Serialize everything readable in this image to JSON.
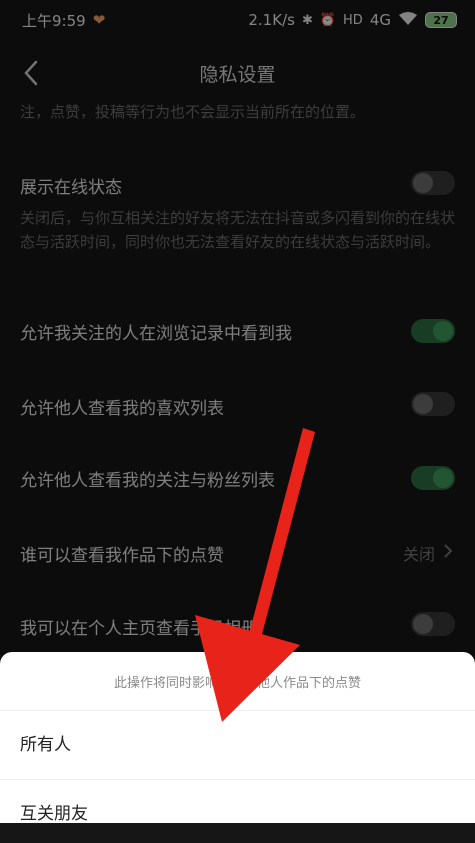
{
  "status_bar": {
    "time": "上午9:59",
    "net_speed": "2.1K/s",
    "hd": "HD",
    "network": "4G",
    "battery": "27"
  },
  "header": {
    "title": "隐私设置"
  },
  "location_note": "注，点赞，投稿等行为也不会显示当前所在的位置。",
  "settings": {
    "online_status": {
      "label": "展示在线状态",
      "desc": "关闭后，与你互相关注的好友将无法在抖音或多闪看到你的在线状态与活跃时间，同时你也无法查看好友的在线状态与活跃时间。",
      "state": "off"
    },
    "browse_record": {
      "label": "允许我关注的人在浏览记录中看到我",
      "state": "on"
    },
    "likes_list": {
      "label": "允许他人查看我的喜欢列表",
      "state": "off"
    },
    "follow_fans_list": {
      "label": "允许他人查看我的关注与粉丝列表",
      "state": "on"
    },
    "who_view_likes": {
      "label": "谁可以查看我作品下的点赞",
      "value": "关闭"
    },
    "phone_album": {
      "label": "我可以在个人主页查看手机相册",
      "state": "off"
    }
  },
  "sheet": {
    "hint": "此操作将同时影响你查看他人作品下的点赞",
    "options": [
      "所有人",
      "互关朋友"
    ]
  },
  "colors": {
    "toggle_on": "#3e9d5b",
    "arrow": "#e8241a",
    "background": "#161616"
  }
}
